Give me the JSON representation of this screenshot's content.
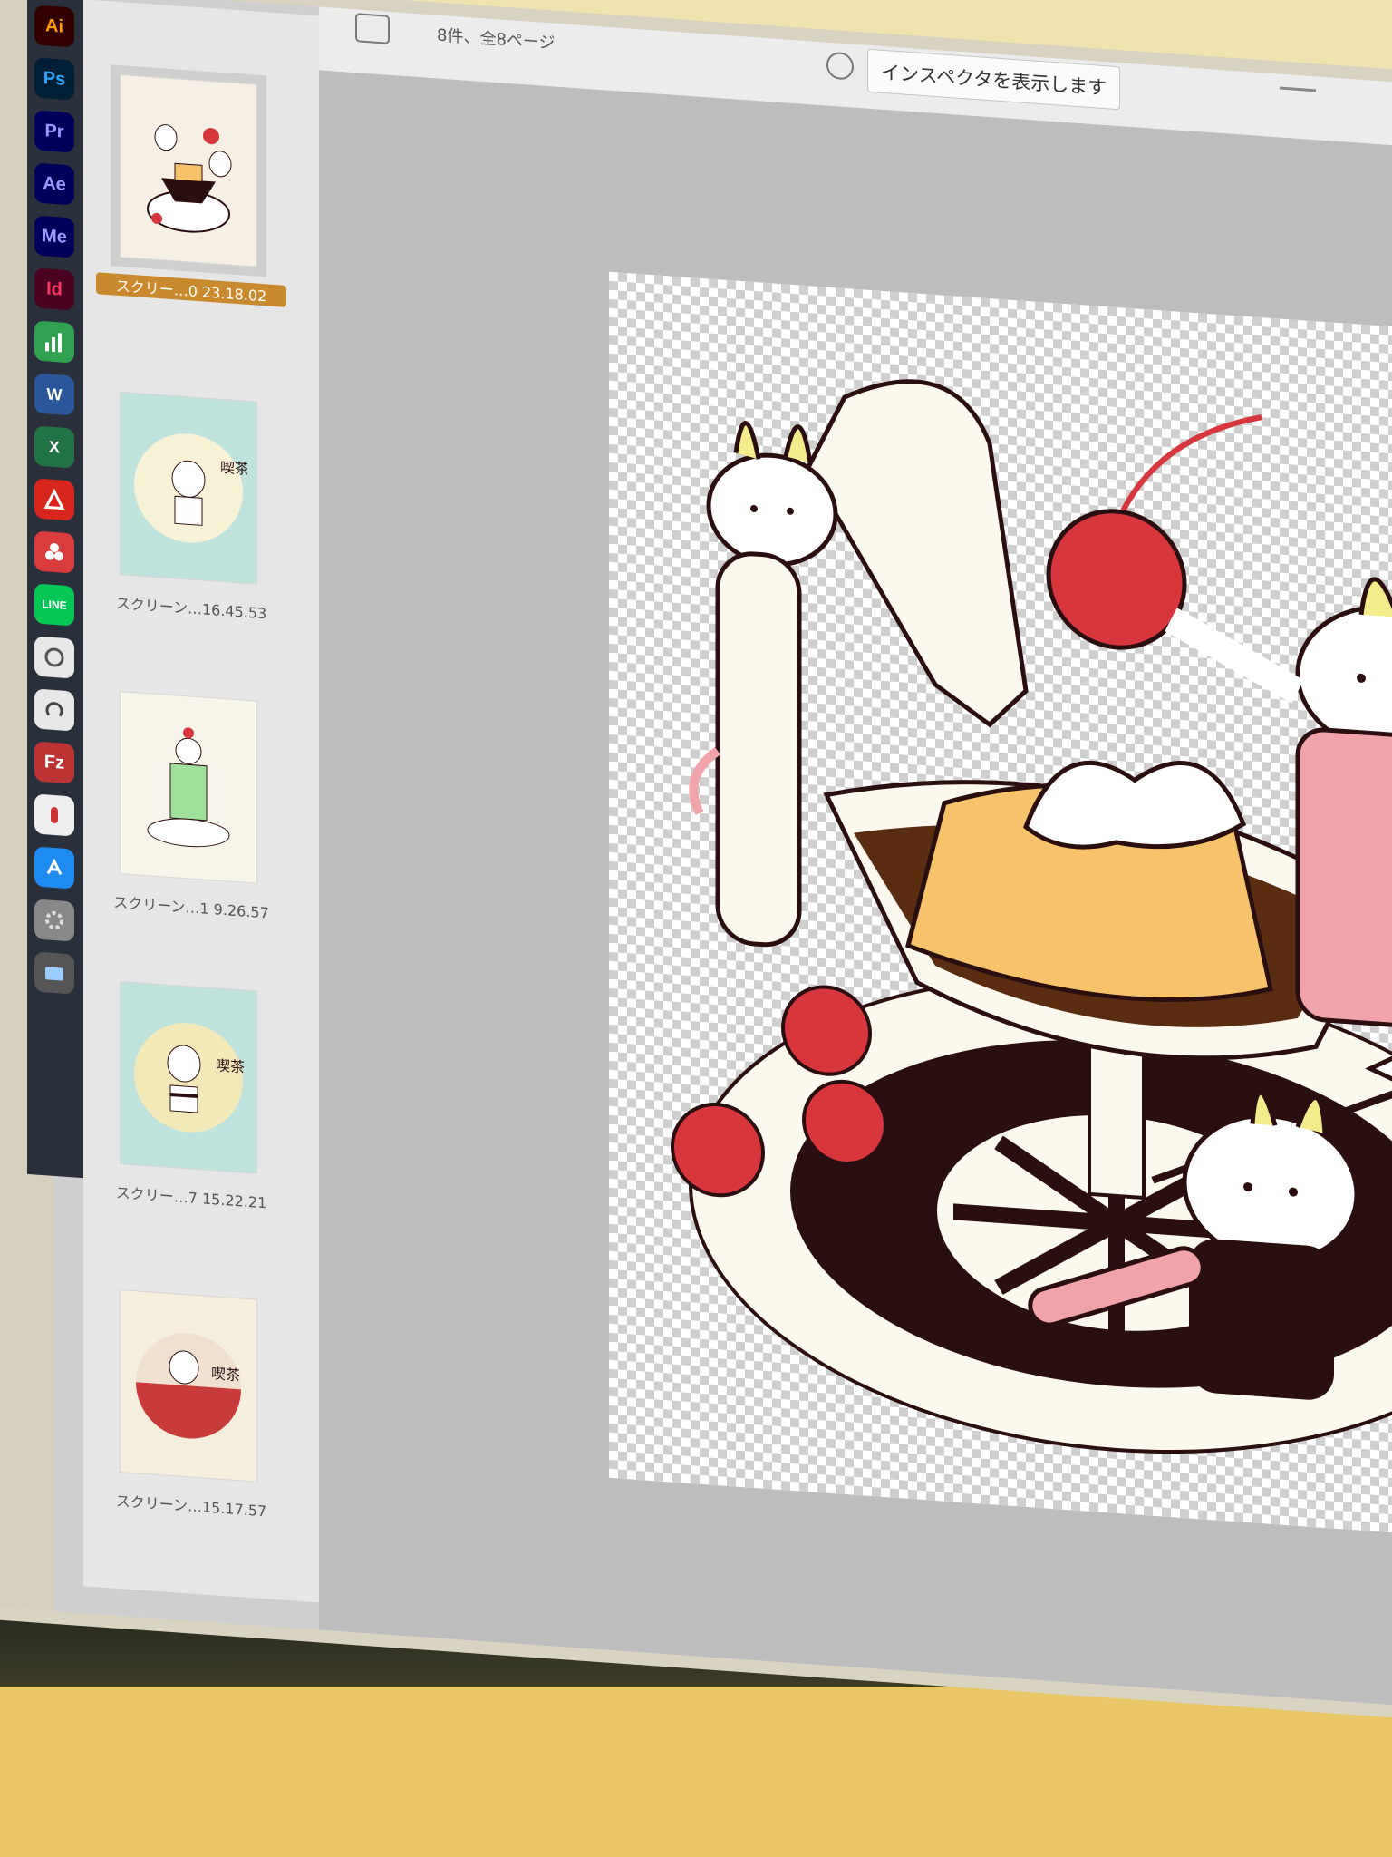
{
  "toolbar": {
    "page_count": "8件、全8ページ",
    "tooltip": "インスペクタを表示します"
  },
  "dock": {
    "apps": [
      {
        "label": "Ai",
        "fg": "#ff9a00",
        "bg": "#330000"
      },
      {
        "label": "Ps",
        "fg": "#31a8ff",
        "bg": "#001e36"
      },
      {
        "label": "Pr",
        "fg": "#9999ff",
        "bg": "#00005b"
      },
      {
        "label": "Ae",
        "fg": "#9999ff",
        "bg": "#00005b"
      },
      {
        "label": "Me",
        "fg": "#9999ff",
        "bg": "#00005b"
      },
      {
        "label": "Id",
        "fg": "#ff3366",
        "bg": "#49021f"
      }
    ]
  },
  "thumbnails": [
    {
      "label": "スクリー…0 23.18.02",
      "selected": true
    },
    {
      "label": "スクリーン…16.45.53",
      "selected": false
    },
    {
      "label": "スクリーン…1 9.26.57",
      "selected": false
    },
    {
      "label": "スクリー…7 15.22.21",
      "selected": false
    },
    {
      "label": "スクリーン…15.17.57",
      "selected": false
    }
  ],
  "colors": {
    "selection": "#c98a2d",
    "cherry": "#d6363c",
    "pudding": "#f6c36b",
    "caramel": "#5a2d10",
    "apron_pink": "#f0a3a8",
    "outline": "#2b0f10",
    "bunny_ear": "#f4ec8a"
  }
}
